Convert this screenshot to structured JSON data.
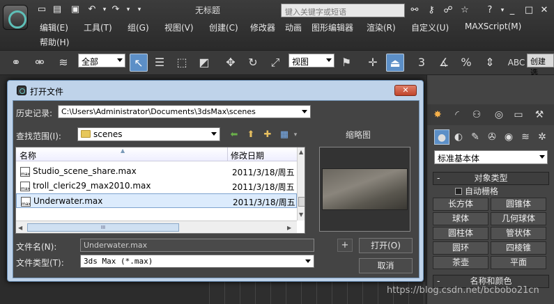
{
  "app": {
    "window_title": "无标题",
    "search_placeholder": "键入关键字或短语"
  },
  "menu": [
    "编辑(E)",
    "工具(T)",
    "组(G)",
    "视图(V)",
    "创建(C)",
    "修改器",
    "动画",
    "图形编辑器",
    "渲染(R)",
    "自定义(U)",
    "MAXScript(M)"
  ],
  "menu_help": "帮助(H)",
  "toolbar": {
    "selection_filter": "全部",
    "ref_coord": "视图",
    "named_selection": "创建选",
    "snap_label": "3"
  },
  "command_panel": {
    "category": "标准基本体",
    "object_type_title": "对象类型",
    "autogrid": "自动栅格",
    "buttons": [
      "长方体",
      "圆锥体",
      "球体",
      "几何球体",
      "圆柱体",
      "管状体",
      "圆环",
      "四棱锥",
      "茶壶",
      "平面"
    ],
    "name_color_title": "名称和颜色"
  },
  "dialog": {
    "title": "打开文件",
    "close_label": "✕",
    "history_label": "历史记录:",
    "history_value": "C:\\Users\\Administrator\\Documents\\3dsMax\\scenes",
    "lookin_label": "查找范围(I):",
    "lookin_value": "scenes",
    "thumbnail_label": "缩略图",
    "columns": {
      "name": "名称",
      "date": "修改日期"
    },
    "files": [
      {
        "icon": "max",
        "name": "Studio_scene_share.max",
        "date": "2011/3/18/周五",
        "selected": false
      },
      {
        "icon": "max",
        "name": "troll_cleric29_max2010.max",
        "date": "2011/3/18/周五",
        "selected": false
      },
      {
        "icon": "max",
        "name": "Underwater.max",
        "date": "2011/3/18/周五",
        "selected": true
      }
    ],
    "filename_label": "文件名(N):",
    "filename_value": "Underwater.max",
    "filetype_label": "文件类型(T):",
    "filetype_value": "3ds Max (*.max)",
    "plus_label": "+",
    "open_label": "打开(O)",
    "cancel_label": "取消",
    "scroll_grip": "III"
  },
  "watermark": "https://blog.csdn.net/bcbobo21cn"
}
